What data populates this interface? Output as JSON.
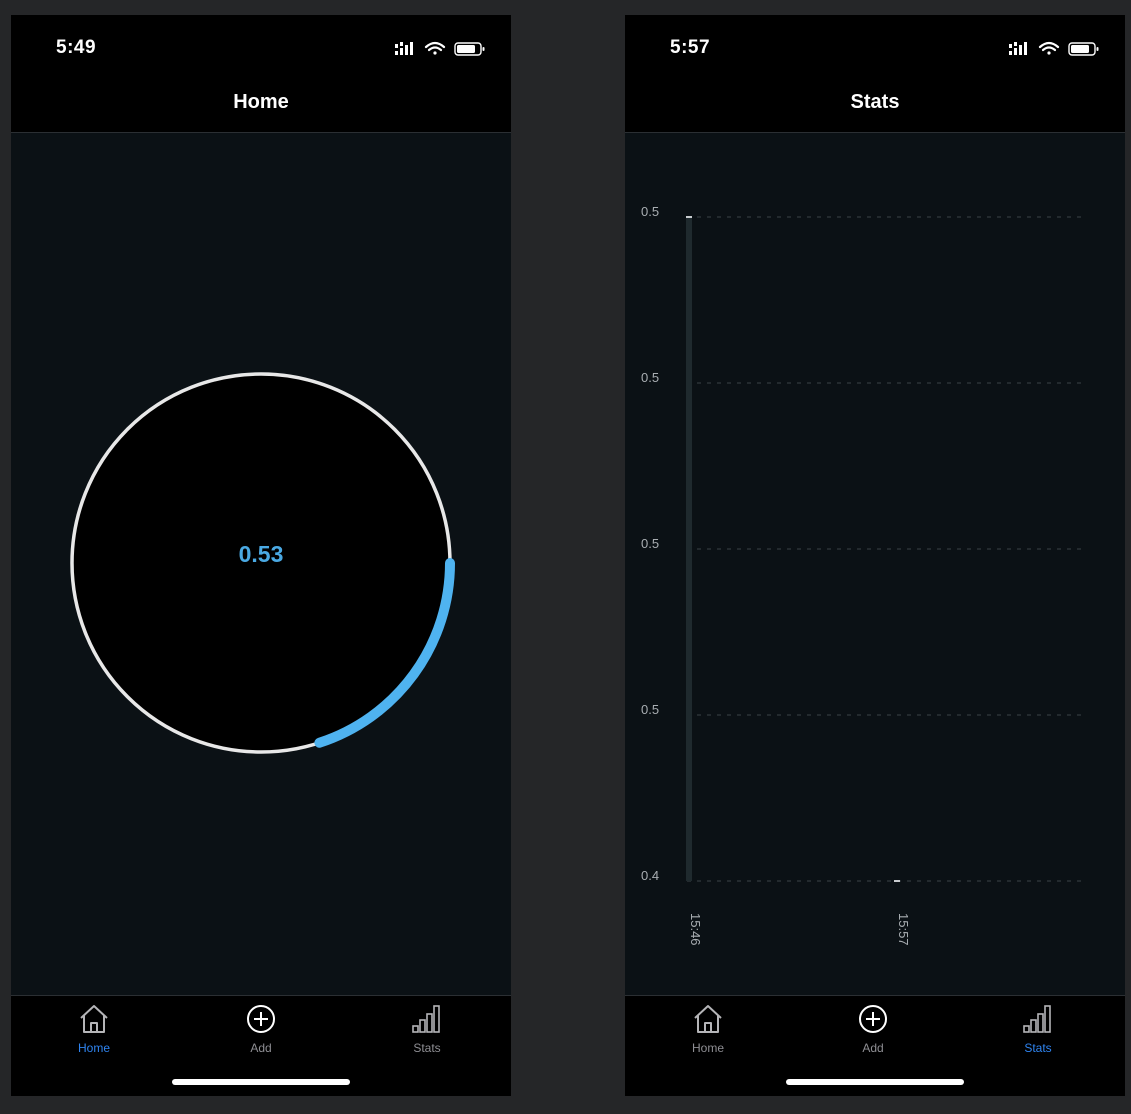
{
  "home_screen": {
    "status": {
      "time": "5:49"
    },
    "title": "Home",
    "gauge": {
      "value_text": "0.53",
      "progress_fraction": 0.2,
      "accent": "#4fb3f0"
    },
    "tabs": [
      {
        "label": "Home",
        "icon": "home-icon",
        "active": true
      },
      {
        "label": "Add",
        "icon": "plus-circle-icon",
        "active": false
      },
      {
        "label": "Stats",
        "icon": "bars-icon",
        "active": false
      }
    ]
  },
  "stats_screen": {
    "status": {
      "time": "5:57"
    },
    "title": "Stats",
    "tabs": [
      {
        "label": "Home",
        "icon": "home-icon",
        "active": false
      },
      {
        "label": "Add",
        "icon": "plus-circle-icon",
        "active": false
      },
      {
        "label": "Stats",
        "icon": "bars-icon",
        "active": true
      }
    ]
  },
  "chart_data": {
    "type": "bar",
    "categories": [
      "15:46",
      "15:57"
    ],
    "values": [
      0.5,
      0.4
    ],
    "ytick_labels": [
      "0.5",
      "0.5",
      "0.5",
      "0.5",
      "0.4"
    ],
    "ylim": [
      0.4,
      0.5
    ],
    "grid": true,
    "grid_style": "dashed-horizontal",
    "bar_color": "#1f2a2e",
    "title": "",
    "xlabel": "",
    "ylabel": ""
  },
  "colors": {
    "background": "#252628",
    "screen": "#0b1115",
    "bar": "#000000",
    "accent": "#4fb3f0",
    "tab_active": "#2f84f0",
    "tab_inactive": "#8e8e93"
  }
}
